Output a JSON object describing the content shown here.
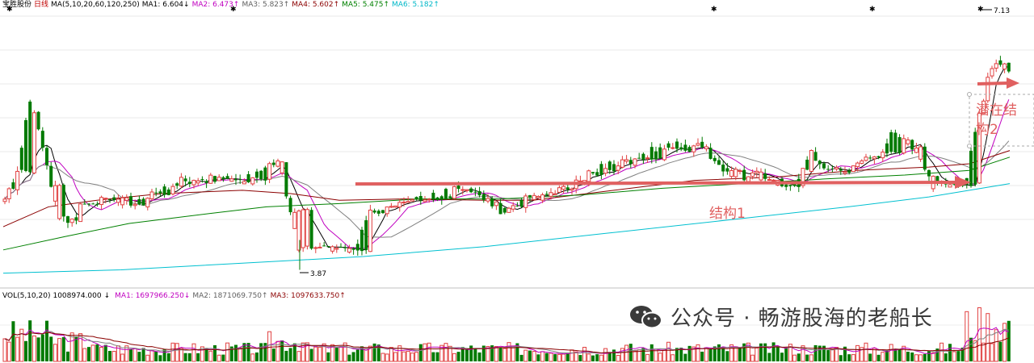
{
  "stock_name": "宝胜股份",
  "period": "日线",
  "ma_header": {
    "label": "MA(5,10,20,60,120,250)",
    "items": [
      {
        "key": "MA1:",
        "value": "6.604",
        "arrow": "↓",
        "color": "#000000"
      },
      {
        "key": "MA2:",
        "value": "6.473",
        "arrow": "↑",
        "color": "#c000c0"
      },
      {
        "key": "MA3:",
        "value": "5.823",
        "arrow": "↑",
        "color": "#606060"
      },
      {
        "key": "MA4:",
        "value": "5.602",
        "arrow": "↑",
        "color": "#8b0000"
      },
      {
        "key": "MA5:",
        "value": "5.475",
        "arrow": "↑",
        "color": "#008000"
      },
      {
        "key": "MA6:",
        "value": "5.182",
        "arrow": "↑",
        "color": "#00b8c8"
      }
    ]
  },
  "vol_header": {
    "label": "VOL(5,10,20)",
    "value": "1008974.000",
    "value_arrow": "↓",
    "items": [
      {
        "key": "MA1:",
        "value": "1697966.250",
        "arrow": "↓",
        "color": "#c000c0"
      },
      {
        "key": "MA2:",
        "value": "1871069.750",
        "arrow": "↑",
        "color": "#606060"
      },
      {
        "key": "MA3:",
        "value": "1097633.750",
        "arrow": "↑",
        "color": "#8b0000"
      }
    ]
  },
  "watermark": "公众号 · 畅游股海的老船长",
  "chart_data": {
    "type": "candlestick",
    "price_range": [
      3.4,
      7.6
    ],
    "low_marker": "3.87",
    "high_marker": "7.13",
    "annotations": [
      "结构1",
      "潜在结构2"
    ],
    "annotation_labels": {
      "structure1": "结构1",
      "structure2_line1": "潜在结",
      "structure2_line2": "构2"
    },
    "colors": {
      "up": "#e04040",
      "down": "#007a00",
      "ma1": "#000000",
      "ma2": "#c000c0",
      "ma3": "#808080",
      "ma4": "#8b0000",
      "ma5": "#008000",
      "ma6": "#00c0d0",
      "arrow": "#e06060"
    }
  }
}
